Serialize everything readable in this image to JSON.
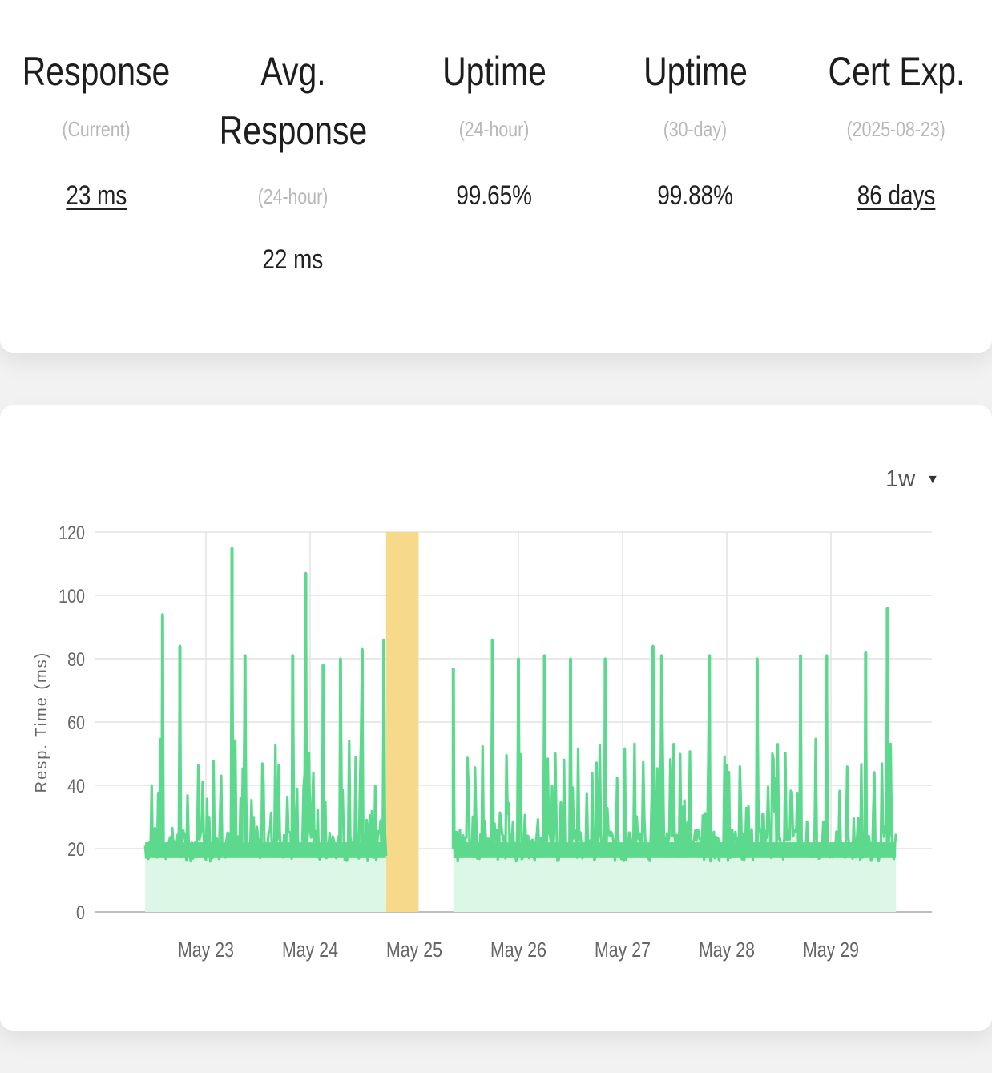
{
  "stats": [
    {
      "title": "Response",
      "sub": "(Current)",
      "value": "23 ms",
      "link": true
    },
    {
      "title": "Avg. Response",
      "sub": "(24-hour)",
      "value": "22 ms",
      "link": false
    },
    {
      "title": "Uptime",
      "sub": "(24-hour)",
      "value": "99.65%",
      "link": false
    },
    {
      "title": "Uptime",
      "sub": "(30-day)",
      "value": "99.88%",
      "link": false
    },
    {
      "title": "Cert Exp.",
      "sub": "(2025-08-23)",
      "value": "86 days",
      "link": true
    }
  ],
  "period": {
    "selected": "1w"
  },
  "colors": {
    "up": "#5dd98e",
    "up_fill": "#ddf7e6",
    "down": "#f7d98b",
    "grid": "#e2e2e2"
  },
  "chart_data": {
    "type": "area",
    "xlabel": "",
    "ylabel": "Resp. Time (ms)",
    "ylim": [
      0,
      120
    ],
    "yticks": [
      0,
      20,
      40,
      60,
      80,
      100,
      120
    ],
    "xticks": [
      "May 23",
      "May 24",
      "May 25",
      "May 26",
      "May 27",
      "May 28",
      "May 29"
    ],
    "x_range_days": [
      "May 22 09:00",
      "May 29 23:00"
    ],
    "downtime": [
      {
        "start": "May 24 17:30",
        "end": "May 25 01:00"
      }
    ],
    "series": [
      {
        "baseline": 20,
        "segments": [
          {
            "start": "May 22 10:00",
            "end": "May 24 17:30"
          },
          {
            "start": "May 25 09:00",
            "end": "May 29 15:00"
          }
        ],
        "peaks": [
          {
            "x": "May 22 14:00",
            "y": 94
          },
          {
            "x": "May 22 18:00",
            "y": 84
          },
          {
            "x": "May 23 06:00",
            "y": 115
          },
          {
            "x": "May 23 09:00",
            "y": 81
          },
          {
            "x": "May 23 20:00",
            "y": 81
          },
          {
            "x": "May 23 23:00",
            "y": 107
          },
          {
            "x": "May 24 03:00",
            "y": 78
          },
          {
            "x": "May 24 07:00",
            "y": 80
          },
          {
            "x": "May 24 12:00",
            "y": 83
          },
          {
            "x": "May 24 17:00",
            "y": 86
          },
          {
            "x": "May 25 09:00",
            "y": 77
          },
          {
            "x": "May 25 18:00",
            "y": 86
          },
          {
            "x": "May 26 00:00",
            "y": 80
          },
          {
            "x": "May 26 06:00",
            "y": 81
          },
          {
            "x": "May 26 12:00",
            "y": 80
          },
          {
            "x": "May 26 20:00",
            "y": 80
          },
          {
            "x": "May 27 07:00",
            "y": 84
          },
          {
            "x": "May 27 09:00",
            "y": 81
          },
          {
            "x": "May 27 20:00",
            "y": 81
          },
          {
            "x": "May 28 07:00",
            "y": 80
          },
          {
            "x": "May 28 17:00",
            "y": 81
          },
          {
            "x": "May 28 23:00",
            "y": 81
          },
          {
            "x": "May 29 08:00",
            "y": 82
          },
          {
            "x": "May 29 13:00",
            "y": 96
          }
        ]
      }
    ]
  }
}
